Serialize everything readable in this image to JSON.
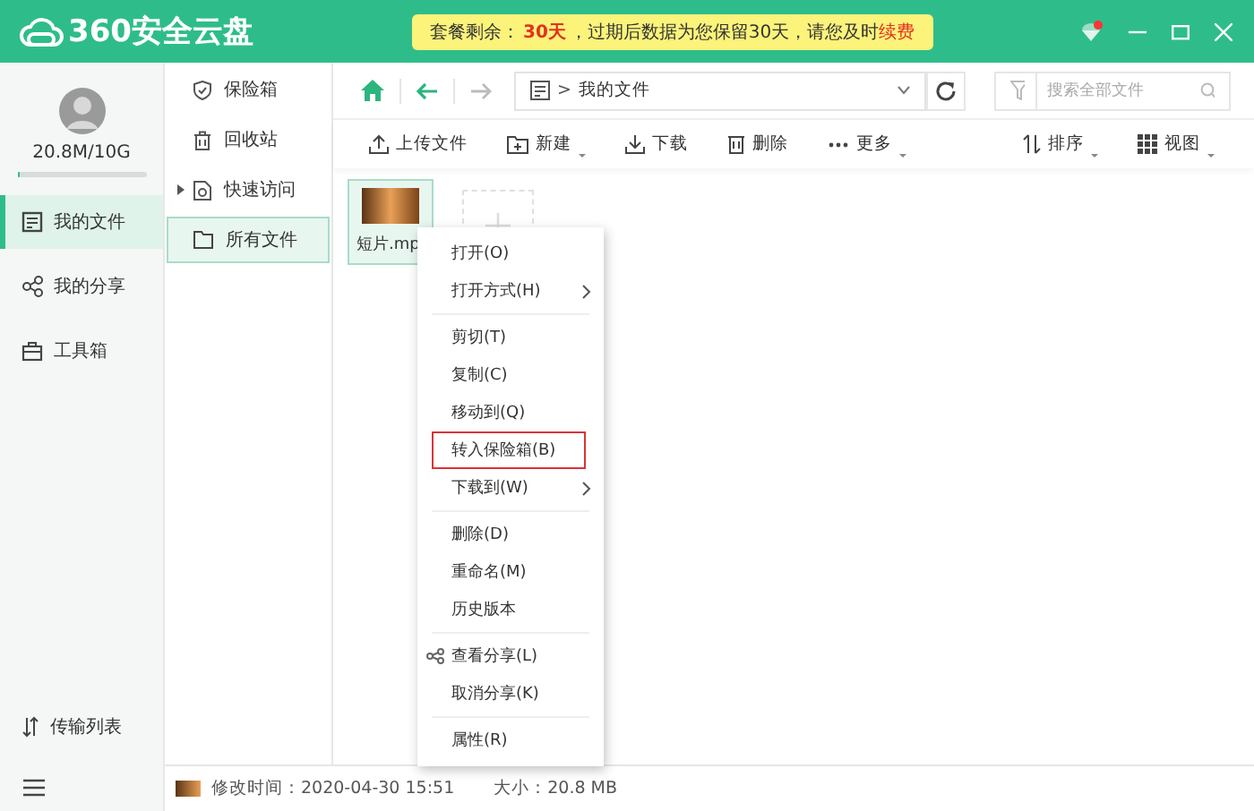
{
  "window": {
    "logo_text": "360安全云盘",
    "banner": {
      "prefix": "套餐剩余：",
      "days": "30天",
      "middle": "，过期后数据为您保留30天，请您及时",
      "link": "续费"
    },
    "skin_notification": true
  },
  "account": {
    "storage": "20.8M/10G",
    "level": 0.002
  },
  "nav": [
    {
      "label": "我的文件",
      "kind": "file",
      "selected": true
    },
    {
      "label": "我的分享",
      "kind": "share",
      "selected": false
    },
    {
      "label": "工具箱",
      "kind": "toolbox",
      "selected": false
    }
  ],
  "nav_bottom": {
    "label": "传输列表"
  },
  "folders": [
    {
      "label": "保险箱",
      "kind": "vault",
      "selected": false,
      "expandable": false
    },
    {
      "label": "回收站",
      "kind": "recycle",
      "selected": false,
      "expandable": false
    },
    {
      "label": "快速访问",
      "kind": "quick",
      "selected": false,
      "expandable": true
    },
    {
      "label": "所有文件",
      "kind": "all",
      "selected": true,
      "expandable": false
    }
  ],
  "path": {
    "separator": ">",
    "segment": "我的文件",
    "search_placeholder": "搜索全部文件",
    "forward_disabled": true
  },
  "toolbar": [
    {
      "label": "上传文件",
      "kind": "upload",
      "dropdown": false
    },
    {
      "label": "新建",
      "kind": "new",
      "dropdown": true
    },
    {
      "label": "下载",
      "kind": "download",
      "dropdown": false
    },
    {
      "label": "删除",
      "kind": "delete",
      "dropdown": false
    },
    {
      "label": "更多",
      "kind": "more",
      "dropdown": true
    }
  ],
  "toolbar_right": [
    {
      "label": "排序",
      "kind": "sort",
      "dropdown": true
    },
    {
      "label": "视图",
      "kind": "view",
      "dropdown": true
    }
  ],
  "files": [
    {
      "name": "短片.mp",
      "selected": true
    }
  ],
  "context_menu": [
    [
      {
        "label": "打开(O)",
        "submenu": false,
        "highlighted": false,
        "share_icon": false
      },
      {
        "label": "打开方式(H)",
        "submenu": true,
        "highlighted": false,
        "share_icon": false
      }
    ],
    [
      {
        "label": "剪切(T)",
        "submenu": false,
        "highlighted": false,
        "share_icon": false
      },
      {
        "label": "复制(C)",
        "submenu": false,
        "highlighted": false,
        "share_icon": false
      },
      {
        "label": "移动到(Q)",
        "submenu": false,
        "highlighted": false,
        "share_icon": false
      },
      {
        "label": "转入保险箱(B)",
        "submenu": false,
        "highlighted": true,
        "share_icon": false
      },
      {
        "label": "下载到(W)",
        "submenu": true,
        "highlighted": false,
        "share_icon": false
      }
    ],
    [
      {
        "label": "删除(D)",
        "submenu": false,
        "highlighted": false,
        "share_icon": false
      },
      {
        "label": "重命名(M)",
        "submenu": false,
        "highlighted": false,
        "share_icon": false
      },
      {
        "label": "历史版本",
        "submenu": false,
        "highlighted": false,
        "share_icon": false
      }
    ],
    [
      {
        "label": "查看分享(L)",
        "submenu": false,
        "highlighted": false,
        "share_icon": true
      },
      {
        "label": "取消分享(K)",
        "submenu": false,
        "highlighted": false,
        "share_icon": false
      }
    ],
    [
      {
        "label": "属性(R)",
        "submenu": false,
        "highlighted": false,
        "share_icon": false
      }
    ]
  ],
  "status_bar": {
    "modified": "修改时间：2020-04-30 15:51",
    "size": "大小：20.8 MB"
  }
}
